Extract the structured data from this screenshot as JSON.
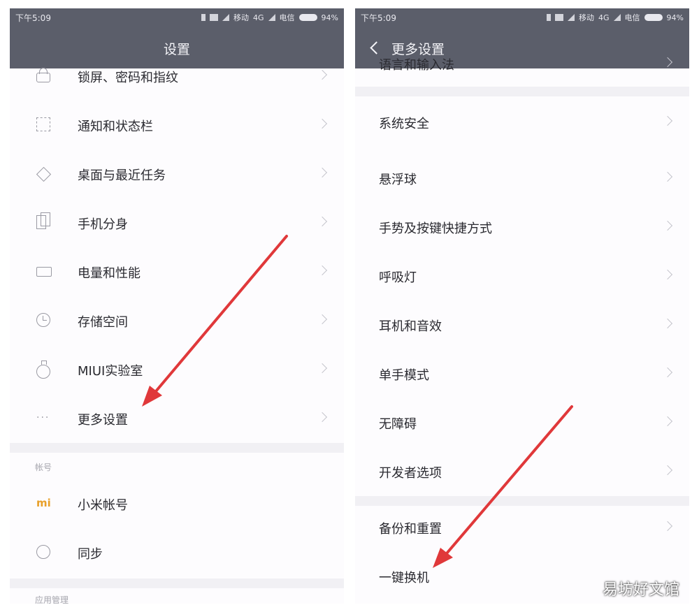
{
  "left": {
    "status": {
      "time": "下午5:09",
      "carrier1": "移动",
      "network": "4G",
      "carrier2": "电信",
      "battery": "94%"
    },
    "title": "设置",
    "items": [
      {
        "label": "锁屏、密码和指纹",
        "icon": "lock-icon"
      },
      {
        "label": "通知和状态栏",
        "icon": "notification-icon"
      },
      {
        "label": "桌面与最近任务",
        "icon": "home-icon"
      },
      {
        "label": "手机分身",
        "icon": "phone-clone-icon"
      },
      {
        "label": "电量和性能",
        "icon": "battery-icon"
      },
      {
        "label": "存储空间",
        "icon": "storage-icon"
      },
      {
        "label": "MIUI实验室",
        "icon": "lab-flask-icon"
      },
      {
        "label": "更多设置",
        "icon": "more-dots-icon"
      }
    ],
    "account_section": "帐号",
    "account_items": [
      {
        "label": "小米帐号",
        "icon": "mi-logo-icon"
      },
      {
        "label": "同步",
        "icon": "sync-icon"
      }
    ],
    "next_section": "应用管理"
  },
  "right": {
    "status": {
      "time": "下午5:09",
      "carrier1": "移动",
      "network": "4G",
      "carrier2": "电信",
      "battery": "94%"
    },
    "title": "更多设置",
    "partial_item": "语言和输入法",
    "group1": [
      "系统安全",
      "悬浮球",
      "手势及按键快捷方式",
      "呼吸灯",
      "耳机和音效",
      "单手模式",
      "无障碍",
      "开发者选项"
    ],
    "group2": [
      "备份和重置",
      "一键换机"
    ]
  },
  "watermark": "易坊好文馆",
  "colors": {
    "header": "#5b5e6a",
    "arrow": "#e0383a",
    "mi_orange": "#e8a02a"
  }
}
